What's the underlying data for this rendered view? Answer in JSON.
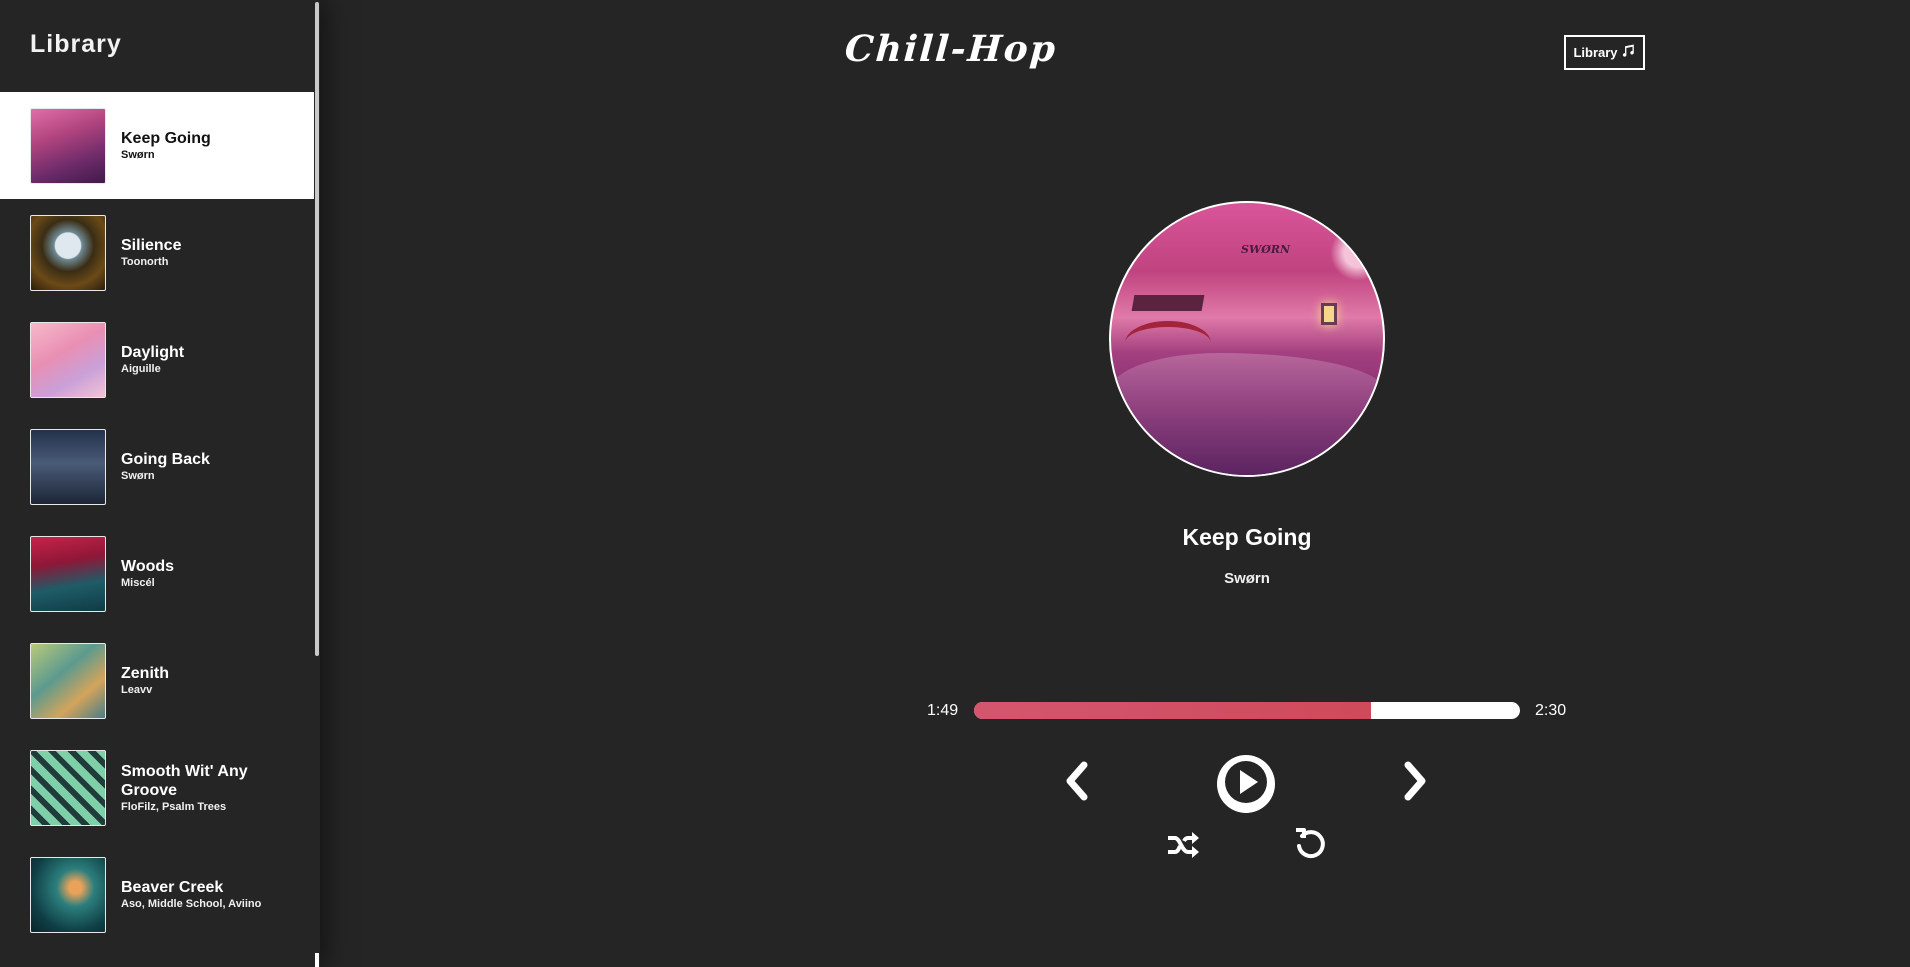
{
  "sidebar": {
    "title": "Library",
    "songs": [
      {
        "name": "Keep Going",
        "artist": "Swørn"
      },
      {
        "name": "Silience",
        "artist": "Toonorth"
      },
      {
        "name": "Daylight",
        "artist": "Aiguille"
      },
      {
        "name": "Going Back",
        "artist": "Swørn"
      },
      {
        "name": "Woods",
        "artist": "Miscél"
      },
      {
        "name": "Zenith",
        "artist": "Leavv"
      },
      {
        "name": "Smooth Wit' Any Groove",
        "artist": "FloFilz, Psalm Trees"
      },
      {
        "name": "Beaver Creek",
        "artist": "Aso, Middle School, Aviino"
      }
    ]
  },
  "header": {
    "logo": "Chill-Hop",
    "library_button": "Library",
    "library_icon": "music-note-icon"
  },
  "player": {
    "title": "Keep Going",
    "artist": "Swørn",
    "cover_brand": "SWØRN",
    "current_time": "1:49",
    "duration": "2:30",
    "progress": 0.727
  },
  "colors": {
    "background": "#252525",
    "progress_fill": "#cf4a5a",
    "active_item": "#ffffff"
  }
}
